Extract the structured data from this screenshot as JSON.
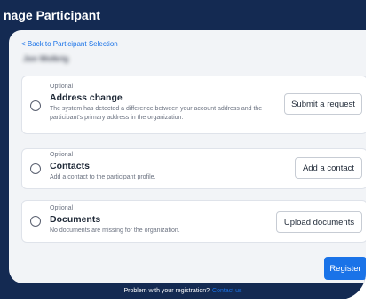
{
  "header": {
    "title": "nage Participant"
  },
  "nav": {
    "back_link": "< Back to Participant Selection"
  },
  "participant": {
    "name": "Jon Wolkrig"
  },
  "cards": [
    {
      "eyebrow": "Optional",
      "title": "Address change",
      "description": "The system has detected a difference between your account address and the participant's primary address in the organization.",
      "button": "Submit a request"
    },
    {
      "eyebrow": "Optional",
      "title": "Contacts",
      "description": "Add a contact to the participant profile.",
      "button": "Add a contact"
    },
    {
      "eyebrow": "Optional",
      "title": "Documents",
      "description": "No documents are missing for the organization.",
      "button": "Upload documents"
    }
  ],
  "actions": {
    "register": "Register"
  },
  "footer": {
    "text": "Problem with your registration?",
    "link": "Contact us"
  },
  "colors": {
    "header_bg": "#142a52",
    "accent": "#1a73e8",
    "content_bg": "#f2f4f7"
  }
}
